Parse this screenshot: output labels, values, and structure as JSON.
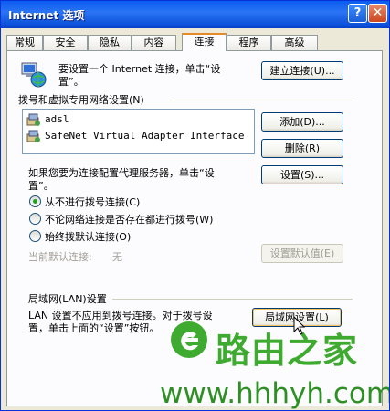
{
  "window": {
    "title": "Internet 选项",
    "help_label": "?",
    "close_label": "✕"
  },
  "tabs": [
    {
      "label": "常规"
    },
    {
      "label": "安全"
    },
    {
      "label": "隐私"
    },
    {
      "label": "内容"
    },
    {
      "label": "连接",
      "active": true
    },
    {
      "label": "程序"
    },
    {
      "label": "高级"
    }
  ],
  "setup": {
    "text_line1": "要设置一个 Internet 连接，单击“设",
    "text_line2": "置”。",
    "button": "建立连接(U)..."
  },
  "dialup": {
    "group_title": "拨号和虚拟专用网络设置(N)",
    "items": [
      {
        "label": "adsl"
      },
      {
        "label": "SafeNet Virtual Adapter Interface"
      }
    ],
    "add_button": "添加(D)...",
    "remove_button": "删除(R)",
    "settings_button": "设置(S)...",
    "proxy_text_line1": "如果您要为连接配置代理服务器，单击“设",
    "proxy_text_line2": "置”。",
    "radios": [
      {
        "label": "从不进行拨号连接(C)",
        "selected": true
      },
      {
        "label": "不论网络连接是否存在都进行拨号(W)",
        "selected": false
      },
      {
        "label": "始终拨默认连接(O)",
        "selected": false
      }
    ],
    "current_default_label": "当前默认连接:",
    "current_default_value": "无",
    "set_default_button": "设置默认值(E)"
  },
  "lan": {
    "group_title": "局域网(LAN)设置",
    "text_line1": "LAN 设置不应用到拨号连接。对于拨号设",
    "text_line2": "置，单击上面的“设置”按钮。",
    "button": "局域网设置(L)"
  },
  "watermark": {
    "brand": "路由之家",
    "url": "www.hhhyh.com"
  },
  "colors": {
    "accent": "#0a5cf0",
    "active_tab": "#e68b2c",
    "radio_dot": "#21a121",
    "watermark": "#3eaa2f"
  }
}
